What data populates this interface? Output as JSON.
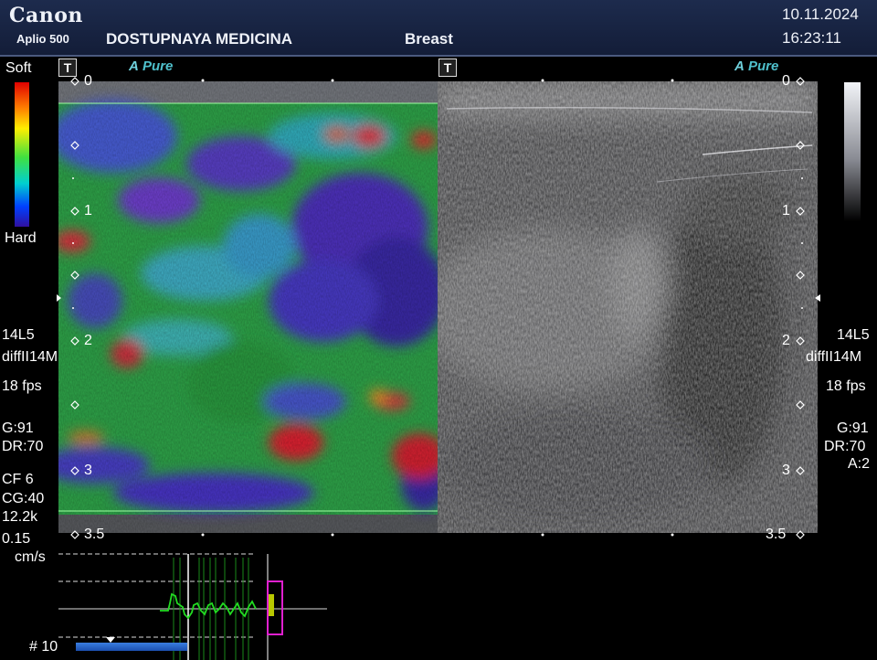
{
  "header": {
    "brand": "Canon",
    "model": "Aplio 500",
    "hospital": "DOSTUPNAYA MEDICINA",
    "preset": "Breast",
    "date": "10.11.2024",
    "time": "16:23:11"
  },
  "panels": {
    "left_marker": "T",
    "right_marker": "T",
    "left_mode": "Pure",
    "right_mode": "Pure",
    "mode_prefix": "A"
  },
  "colorbar": {
    "top_label": "Soft",
    "bottom_label": "Hard"
  },
  "depth_scale": {
    "left": [
      "0",
      "1",
      "2",
      "3",
      "3.5"
    ],
    "right": [
      "0",
      "1",
      "2",
      "3",
      "3.5"
    ]
  },
  "left_params": {
    "probe": "14L5",
    "preset": "diffII14M",
    "fps": "18 fps",
    "gain": "G:91",
    "dr": "DR:70",
    "cf": "CF 6",
    "cg": "CG:40",
    "prf": "12.2k",
    "velocity": "0.15",
    "velocity_unit": "cm/s"
  },
  "right_params": {
    "probe": "14L5",
    "preset": "diffII14M",
    "fps": "18 fps",
    "gain": "G:91",
    "dr": "DR:70",
    "a": "A:2"
  },
  "footer": {
    "frame": "# 10"
  },
  "colors": {
    "header_bg": "#1a2747",
    "accent_cyan": "#4fc0cc",
    "graph_line": "#22dd22",
    "marker_magenta": "#e020d0",
    "marker_yellow": "#b8c800",
    "progress_blue": "#2a64c8"
  }
}
